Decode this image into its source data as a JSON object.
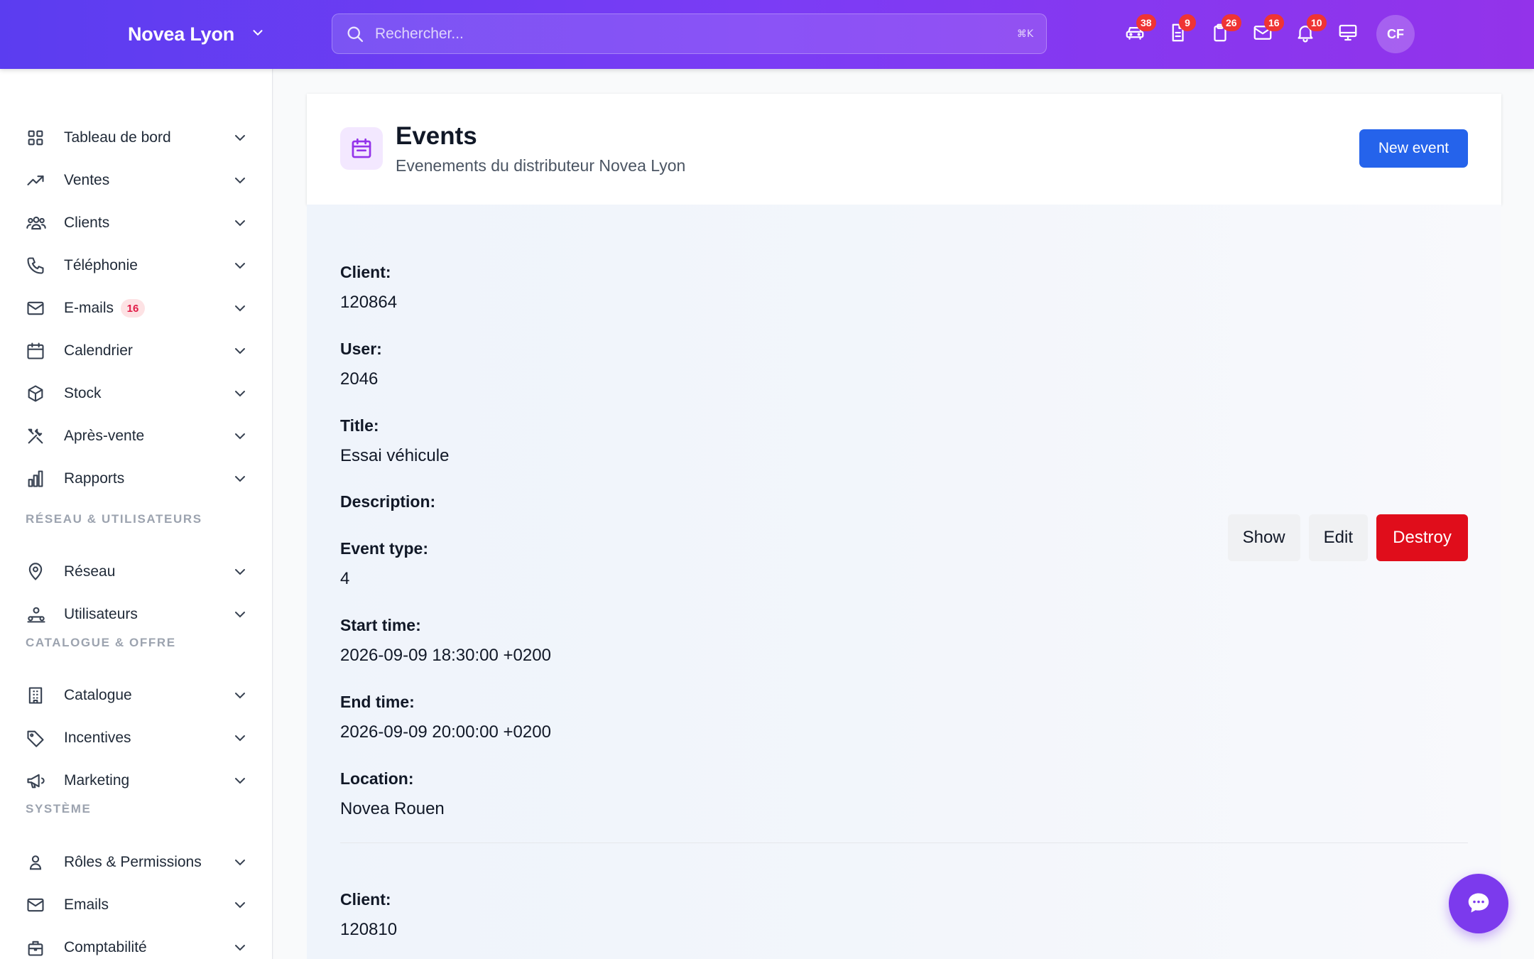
{
  "topbar": {
    "brand": "Novea Lyon",
    "search_placeholder": "Rechercher...",
    "search_shortcut": "⌘K",
    "icons": [
      {
        "name": "car-icon",
        "badge": "38"
      },
      {
        "name": "document-icon",
        "badge": "9"
      },
      {
        "name": "clipboard-icon",
        "badge": "26"
      },
      {
        "name": "mail-icon",
        "badge": "16"
      },
      {
        "name": "bell-icon",
        "badge": "10"
      },
      {
        "name": "monitor-icon",
        "badge": ""
      }
    ],
    "avatar_initials": "CF"
  },
  "sidebar": {
    "items": [
      {
        "label": "Tableau de bord",
        "icon": "grid-icon"
      },
      {
        "label": "Ventes",
        "icon": "trending-up-icon"
      },
      {
        "label": "Clients",
        "icon": "users-icon"
      },
      {
        "label": "Téléphonie",
        "icon": "phone-icon"
      },
      {
        "label": "E-mails",
        "icon": "mail-icon",
        "badge": "16"
      },
      {
        "label": "Calendrier",
        "icon": "calendar-icon"
      },
      {
        "label": "Stock",
        "icon": "cube-icon"
      },
      {
        "label": "Après-vente",
        "icon": "tools-icon"
      },
      {
        "label": "Rapports",
        "icon": "bar-chart-icon"
      }
    ],
    "sections": [
      {
        "title": "RÉSEAU & UTILISATEURS",
        "items": [
          {
            "label": "Réseau",
            "icon": "map-pin-icon"
          },
          {
            "label": "Utilisateurs",
            "icon": "user-group-icon"
          }
        ]
      },
      {
        "title": "CATALOGUE & OFFRE",
        "items": [
          {
            "label": "Catalogue",
            "icon": "building-icon"
          },
          {
            "label": "Incentives",
            "icon": "tag-icon"
          },
          {
            "label": "Marketing",
            "icon": "megaphone-icon"
          }
        ]
      },
      {
        "title": "SYSTÈME",
        "items": [
          {
            "label": "Rôles & Permissions",
            "icon": "user-icon"
          },
          {
            "label": "Emails",
            "icon": "mail-icon"
          },
          {
            "label": "Comptabilité",
            "icon": "briefcase-icon"
          }
        ]
      }
    ]
  },
  "header": {
    "title": "Events",
    "subtitle": "Evenements du distributeur Novea Lyon",
    "new_button": "New event"
  },
  "records": [
    {
      "fields": [
        {
          "label": "Client:",
          "value": "120864"
        },
        {
          "label": "User:",
          "value": "2046"
        },
        {
          "label": "Title:",
          "value": "Essai véhicule"
        },
        {
          "label": "Description:",
          "value": ""
        },
        {
          "label": "Event type:",
          "value": "4"
        },
        {
          "label": "Start time:",
          "value": "2026-09-09 18:30:00 +0200"
        },
        {
          "label": "End time:",
          "value": "2026-09-09 20:00:00 +0200"
        },
        {
          "label": "Location:",
          "value": "Novea Rouen"
        }
      ],
      "actions": {
        "show": "Show",
        "edit": "Edit",
        "destroy": "Destroy"
      }
    },
    {
      "fields": [
        {
          "label": "Client:",
          "value": "120810"
        }
      ]
    }
  ],
  "colors": {
    "accent": "#2563eb",
    "brand_gradient_start": "#5b3df0",
    "brand_gradient_end": "#9333ea",
    "danger": "#e00d1b"
  }
}
